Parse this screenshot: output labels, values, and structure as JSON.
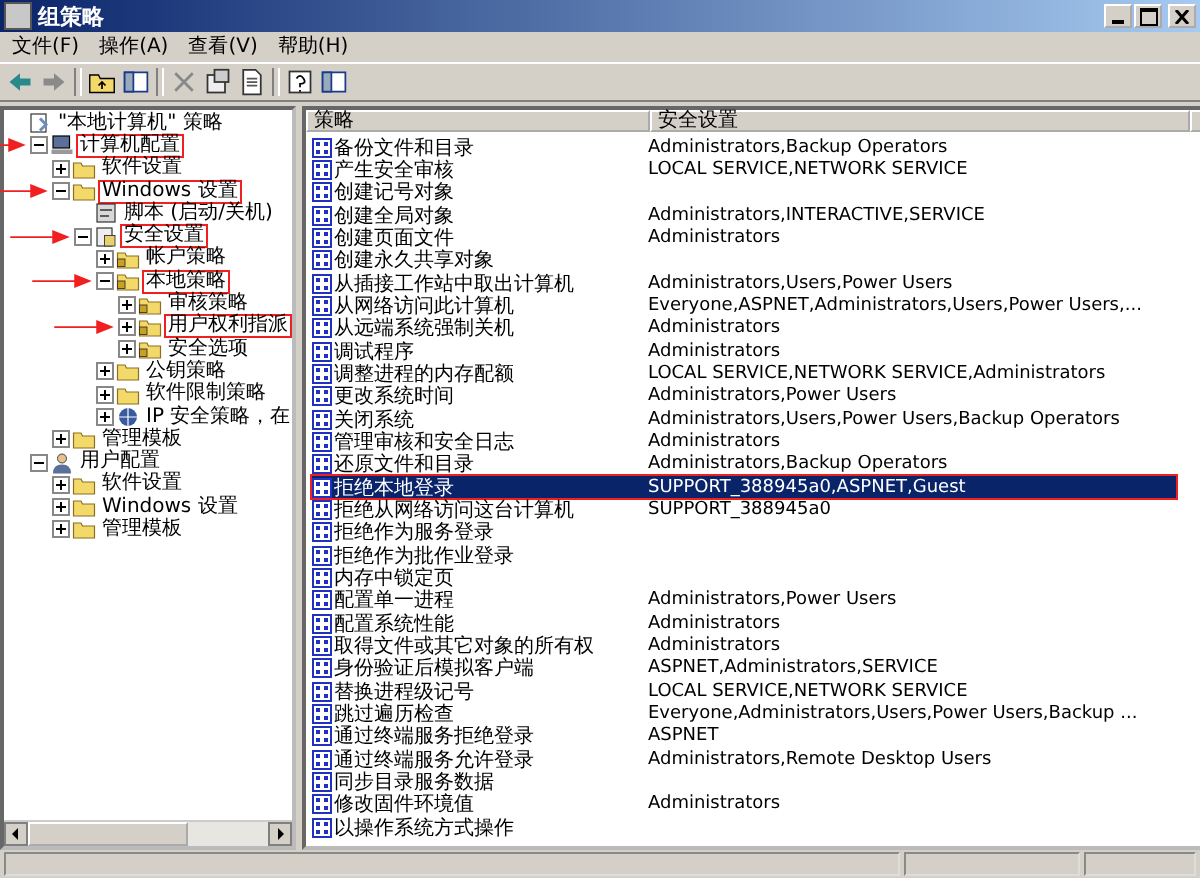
{
  "window": {
    "title": "组策略"
  },
  "menu": [
    "文件(F)",
    "操作(A)",
    "查看(V)",
    "帮助(H)"
  ],
  "toolbar": [
    {
      "kind": "back"
    },
    {
      "kind": "forward"
    },
    {
      "kind": "sep"
    },
    {
      "kind": "up"
    },
    {
      "kind": "pane"
    },
    {
      "kind": "sep"
    },
    {
      "kind": "delete"
    },
    {
      "kind": "props"
    },
    {
      "kind": "export"
    },
    {
      "kind": "sep"
    },
    {
      "kind": "help"
    },
    {
      "kind": "pane"
    }
  ],
  "tree": [
    {
      "label": "\"本地计算机\" 策略",
      "kind": "policy",
      "marked": false,
      "children": [
        {
          "label": "计算机配置",
          "kind": "computer",
          "expanded": true,
          "marked": true,
          "children": [
            {
              "label": "软件设置",
              "kind": "folder",
              "expanded": false,
              "marked": false
            },
            {
              "label": "Windows 设置",
              "kind": "folder",
              "expanded": true,
              "marked": true,
              "children": [
                {
                  "label": "脚本 (启动/关机)",
                  "kind": "script",
                  "marked": false
                },
                {
                  "label": "安全设置",
                  "kind": "security",
                  "expanded": true,
                  "marked": true,
                  "children": [
                    {
                      "label": "帐户策略",
                      "kind": "lockfolder",
                      "expanded": false,
                      "marked": false
                    },
                    {
                      "label": "本地策略",
                      "kind": "lockfolder",
                      "expanded": true,
                      "marked": true,
                      "children": [
                        {
                          "label": "审核策略",
                          "kind": "lockfolder",
                          "expanded": false,
                          "marked": false
                        },
                        {
                          "label": "用户权利指派",
                          "kind": "lockfolder",
                          "expanded": false,
                          "marked": true
                        },
                        {
                          "label": "安全选项",
                          "kind": "lockfolder",
                          "expanded": false,
                          "marked": false
                        }
                      ]
                    },
                    {
                      "label": "公钥策略",
                      "kind": "folder",
                      "expanded": false,
                      "marked": false
                    },
                    {
                      "label": "软件限制策略",
                      "kind": "folder",
                      "expanded": false,
                      "marked": false
                    },
                    {
                      "label": "IP 安全策略，在",
                      "kind": "ip",
                      "expanded": false,
                      "marked": false
                    }
                  ]
                }
              ]
            },
            {
              "label": "管理模板",
              "kind": "folder",
              "expanded": false,
              "marked": false
            }
          ]
        },
        {
          "label": "用户配置",
          "kind": "user",
          "expanded": true,
          "marked": false,
          "children": [
            {
              "label": "软件设置",
              "kind": "folder",
              "expanded": false,
              "marked": false
            },
            {
              "label": "Windows 设置",
              "kind": "folder",
              "expanded": false,
              "marked": false
            },
            {
              "label": "管理模板",
              "kind": "folder",
              "expanded": false,
              "marked": false
            }
          ]
        }
      ]
    }
  ],
  "table": {
    "columns": [
      "策略",
      "安全设置"
    ],
    "rows": [
      {
        "name": "备份文件和目录",
        "setting": "Administrators,Backup Operators",
        "selected": false,
        "marked": false
      },
      {
        "name": "产生安全审核",
        "setting": "LOCAL SERVICE,NETWORK SERVICE",
        "selected": false,
        "marked": false
      },
      {
        "name": "创建记号对象",
        "setting": "",
        "selected": false,
        "marked": false
      },
      {
        "name": "创建全局对象",
        "setting": "Administrators,INTERACTIVE,SERVICE",
        "selected": false,
        "marked": false
      },
      {
        "name": "创建页面文件",
        "setting": "Administrators",
        "selected": false,
        "marked": false
      },
      {
        "name": "创建永久共享对象",
        "setting": "",
        "selected": false,
        "marked": false
      },
      {
        "name": "从插接工作站中取出计算机",
        "setting": "Administrators,Users,Power Users",
        "selected": false,
        "marked": false
      },
      {
        "name": "从网络访问此计算机",
        "setting": "Everyone,ASPNET,Administrators,Users,Power Users,...",
        "selected": false,
        "marked": false
      },
      {
        "name": "从远端系统强制关机",
        "setting": "Administrators",
        "selected": false,
        "marked": false
      },
      {
        "name": "调试程序",
        "setting": "Administrators",
        "selected": false,
        "marked": false
      },
      {
        "name": "调整进程的内存配额",
        "setting": "LOCAL SERVICE,NETWORK SERVICE,Administrators",
        "selected": false,
        "marked": false
      },
      {
        "name": "更改系统时间",
        "setting": "Administrators,Power Users",
        "selected": false,
        "marked": false
      },
      {
        "name": "关闭系统",
        "setting": "Administrators,Users,Power Users,Backup Operators",
        "selected": false,
        "marked": false
      },
      {
        "name": "管理审核和安全日志",
        "setting": "Administrators",
        "selected": false,
        "marked": false
      },
      {
        "name": "还原文件和目录",
        "setting": "Administrators,Backup Operators",
        "selected": false,
        "marked": false
      },
      {
        "name": "拒绝本地登录",
        "setting": "SUPPORT_388945a0,ASPNET,Guest",
        "selected": true,
        "marked": true
      },
      {
        "name": "拒绝从网络访问这台计算机",
        "setting": "SUPPORT_388945a0",
        "selected": false,
        "marked": false
      },
      {
        "name": "拒绝作为服务登录",
        "setting": "",
        "selected": false,
        "marked": false
      },
      {
        "name": "拒绝作为批作业登录",
        "setting": "",
        "selected": false,
        "marked": false
      },
      {
        "name": "内存中锁定页",
        "setting": "",
        "selected": false,
        "marked": false
      },
      {
        "name": "配置单一进程",
        "setting": "Administrators,Power Users",
        "selected": false,
        "marked": false
      },
      {
        "name": "配置系统性能",
        "setting": "Administrators",
        "selected": false,
        "marked": false
      },
      {
        "name": "取得文件或其它对象的所有权",
        "setting": "Administrators",
        "selected": false,
        "marked": false
      },
      {
        "name": "身份验证后模拟客户端",
        "setting": "ASPNET,Administrators,SERVICE",
        "selected": false,
        "marked": false
      },
      {
        "name": "替换进程级记号",
        "setting": "LOCAL SERVICE,NETWORK SERVICE",
        "selected": false,
        "marked": false
      },
      {
        "name": "跳过遍历检查",
        "setting": "Everyone,Administrators,Users,Power Users,Backup ...",
        "selected": false,
        "marked": false
      },
      {
        "name": "通过终端服务拒绝登录",
        "setting": "ASPNET",
        "selected": false,
        "marked": false
      },
      {
        "name": "通过终端服务允许登录",
        "setting": "Administrators,Remote Desktop Users",
        "selected": false,
        "marked": false
      },
      {
        "name": "同步目录服务数据",
        "setting": "",
        "selected": false,
        "marked": false
      },
      {
        "name": "修改固件环境值",
        "setting": "Administrators",
        "selected": false,
        "marked": false
      },
      {
        "name": "以操作系统方式操作",
        "setting": "",
        "selected": false,
        "marked": false
      }
    ]
  }
}
